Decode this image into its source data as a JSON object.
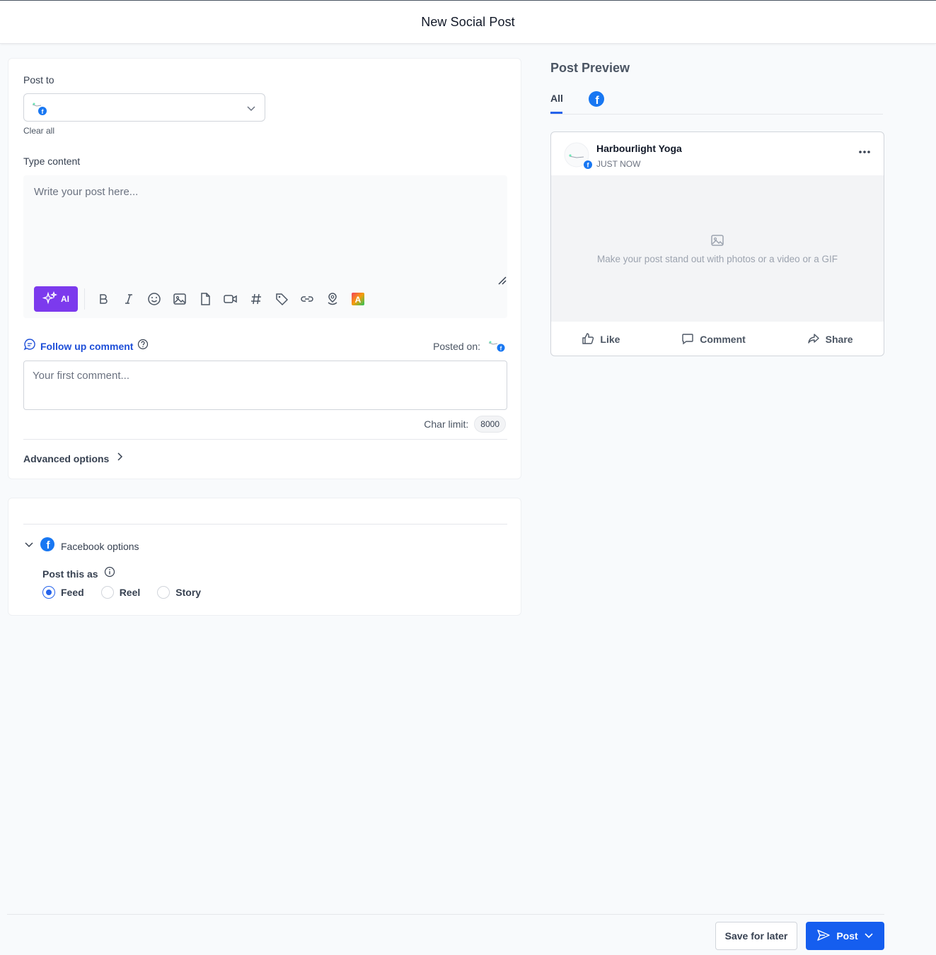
{
  "header": {
    "title": "New Social Post"
  },
  "compose": {
    "post_to_label": "Post to",
    "clear_all": "Clear all",
    "type_content_label": "Type content",
    "content_placeholder": "Write your post here...",
    "ai_label": "AI",
    "toolbar_icons": [
      "bold-icon",
      "italic-icon",
      "emoji-icon",
      "image-icon",
      "file-icon",
      "video-icon",
      "hashtag-icon",
      "tag-icon",
      "link-icon",
      "location-icon",
      "canva-icon"
    ],
    "follow_up_label": "Follow up comment",
    "posted_on_label": "Posted on:",
    "comment_placeholder": "Your first comment...",
    "char_limit_label": "Char limit:",
    "char_limit_value": "8000",
    "advanced_label": "Advanced options"
  },
  "facebook_options": {
    "title": "Facebook options",
    "post_as_label": "Post this as",
    "options": [
      {
        "label": "Feed",
        "checked": true
      },
      {
        "label": "Reel",
        "checked": false
      },
      {
        "label": "Story",
        "checked": false
      }
    ]
  },
  "preview": {
    "title": "Post Preview",
    "tab_all": "All",
    "page_name": "Harbourlight Yoga",
    "time": "JUST NOW",
    "media_placeholder": "Make your post stand out with photos or a video or a GIF",
    "actions": {
      "like": "Like",
      "comment": "Comment",
      "share": "Share"
    }
  },
  "footer": {
    "save_label": "Save for later",
    "post_label": "Post"
  },
  "colors": {
    "primary": "#155eef",
    "ai_purple": "#7c3aed",
    "facebook_blue": "#1877f2",
    "link_blue": "#1d4ed8"
  }
}
